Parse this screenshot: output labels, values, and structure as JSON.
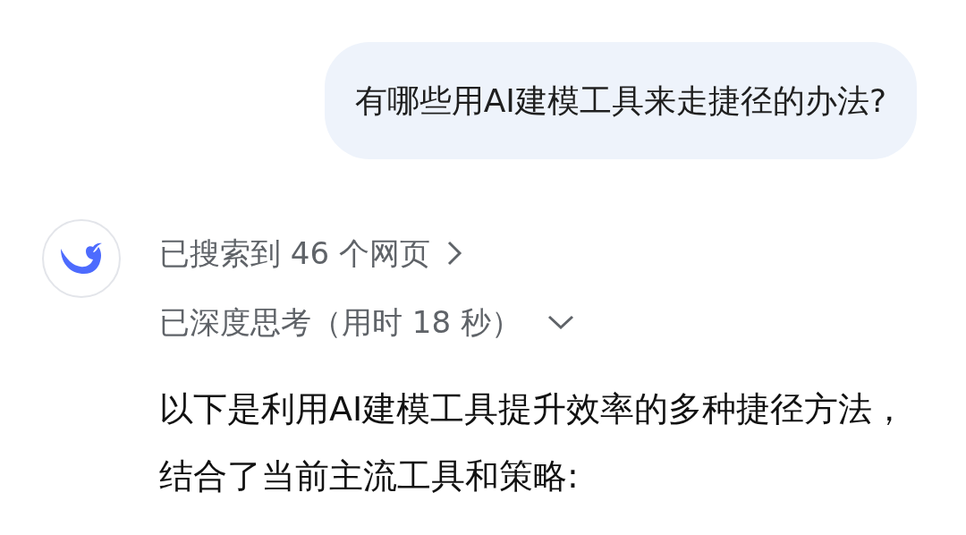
{
  "user_message": {
    "text": "有哪些用AI建模工具来走捷径的办法?"
  },
  "search_status": {
    "label": "已搜索到 46 个网页"
  },
  "thinking_status": {
    "label": "已深度思考（用时 18 秒）",
    "expanded": false
  },
  "answer": {
    "text": "以下是利用AI建模工具提升效率的多种捷径方法，结合了当前主流工具和策略:"
  }
}
